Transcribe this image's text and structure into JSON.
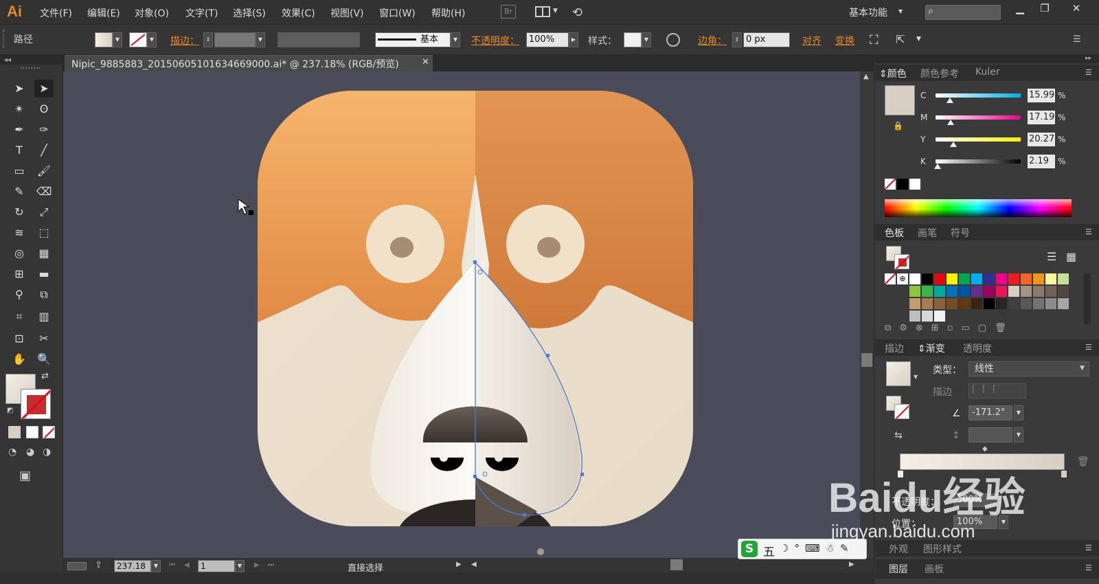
{
  "app": {
    "logo": "Ai"
  },
  "menu": [
    "文件(F)",
    "编辑(E)",
    "对象(O)",
    "文字(T)",
    "选择(S)",
    "效果(C)",
    "视图(V)",
    "窗口(W)",
    "帮助(H)"
  ],
  "bridge_label": "Br",
  "workspace_label": "基本功能",
  "control": {
    "object_type": "路径",
    "stroke_label": "描边",
    "stroke_profile": "基本",
    "opacity_label": "不透明度",
    "opacity_value": "100%",
    "style_label": "样式",
    "corner_label": "边角",
    "corner_value": "0 px",
    "align_label": "对齐",
    "transform_label": "变换"
  },
  "document": {
    "title": "Nipic_9885883_20150605101634669000.ai* @ 237.18% (RGB/预览)"
  },
  "status": {
    "zoom": "237.18",
    "artboard": "1",
    "tool_name": "直接选择"
  },
  "color_panel": {
    "tabs": [
      "颜色",
      "颜色参考",
      "Kuler"
    ],
    "channels": [
      {
        "label": "C",
        "value": "15.99",
        "fraction": 0.16,
        "gradient": [
          "#ffffff",
          "#00aeef"
        ]
      },
      {
        "label": "M",
        "value": "17.19",
        "fraction": 0.17,
        "gradient": [
          "#ffffff",
          "#ec008c"
        ]
      },
      {
        "label": "Y",
        "value": "20.27",
        "fraction": 0.2,
        "gradient": [
          "#ffffff",
          "#fff200"
        ]
      },
      {
        "label": "K",
        "value": "2.19",
        "fraction": 0.02,
        "gradient": [
          "#ffffff",
          "#000000"
        ]
      }
    ],
    "percent": "%",
    "current_color": "#d8cfc2"
  },
  "swatches_panel": {
    "tabs": [
      "色板",
      "画笔",
      "符号"
    ],
    "colors": [
      "#ffffff",
      "#000000",
      "#e30613",
      "#fff200",
      "#00a651",
      "#00aeef",
      "#2e3192",
      "#ec008c",
      "#ed1c24",
      "#f26522",
      "#f7941d",
      "#fff799",
      "#c4df9b",
      "#8dc63f",
      "#39b54a",
      "#00a99d",
      "#0072bc",
      "#0054a6",
      "#662d91",
      "#9e005d",
      "#ed145b",
      "#d8cfc2",
      "#a39382",
      "#8c7b6b",
      "#736357",
      "#534741",
      "#c69c6d",
      "#a67c52",
      "#8c6239",
      "#754c24",
      "#603913",
      "#3c2415",
      "#000000",
      "#262626",
      "#404040",
      "#595959",
      "#737373",
      "#8c8c8c",
      "#a6a6a6",
      "#bfbfbf",
      "#d9d9d9",
      "#f2f2f2"
    ]
  },
  "gradient_panel": {
    "tabs": [
      "描边",
      "渐变",
      "透明度"
    ],
    "type_label": "类型",
    "type_value": "线性",
    "stroke_label": "描边",
    "angle": "-171.2°",
    "opacity_label": "不透明度",
    "opacity_value": "100%",
    "position_label": "位置",
    "position_value": "100%",
    "stops": [
      "#f4efe6",
      "#d8cfc2"
    ]
  },
  "bottom_tabs": [
    "外观",
    "图形样式"
  ],
  "layer_tabs": [
    "图层",
    "画板"
  ],
  "ime": {
    "label": "五"
  },
  "watermark": {
    "brand": "Baidu经验",
    "url": "jingyan.baidu.com"
  }
}
